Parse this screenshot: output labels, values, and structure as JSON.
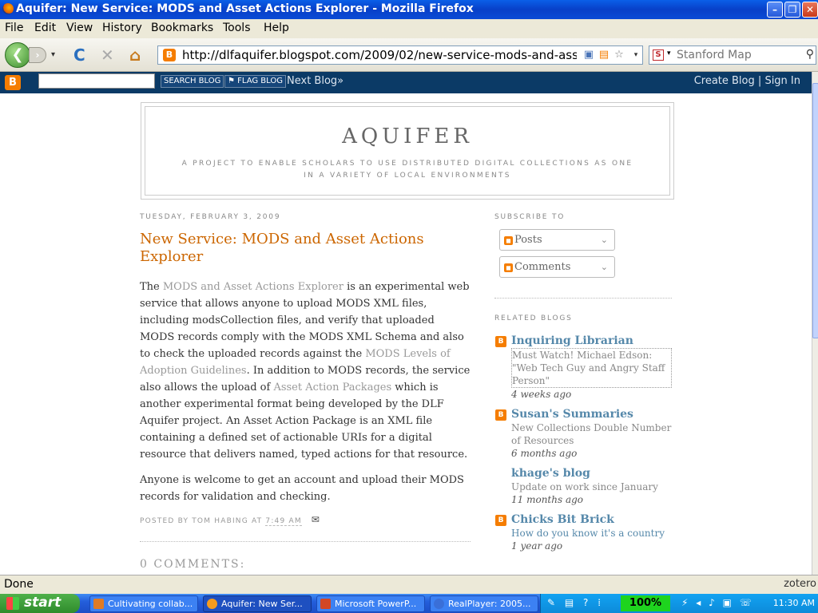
{
  "window": {
    "title": "Aquifer: New Service: MODS and Asset Actions Explorer - Mozilla Firefox",
    "minimize": "–",
    "maximize": "❐",
    "close": "✕"
  },
  "menu": [
    "File",
    "Edit",
    "View",
    "History",
    "Bookmarks",
    "Tools",
    "Help"
  ],
  "nav": {
    "back": "❮",
    "forward": "›",
    "reload": "C",
    "stop": "✕",
    "home": "⌂",
    "url": "http://dlfaquifer.blogspot.com/2009/02/new-service-mods-and-asset-actions",
    "site_favicon": "B",
    "search_engine": "S",
    "search_placeholder": "Stanford Map"
  },
  "blogger_bar": {
    "logo": "B",
    "search_button": "SEARCH BLOG",
    "flag_button": "FLAG BLOG",
    "next_blog": "Next Blog»",
    "create_blog": "Create Blog",
    "divider": "|",
    "sign_in": "Sign In"
  },
  "blog": {
    "title": "AQUIFER",
    "description": "A PROJECT TO ENABLE SCHOLARS TO USE DISTRIBUTED DIGITAL COLLECTIONS AS ONE IN A VARIETY OF LOCAL ENVIRONMENTS"
  },
  "post": {
    "date": "TUESDAY, FEBRUARY 3, 2009",
    "title": "New Service: MODS and Asset Actions Explorer",
    "p1": {
      "t1": "The ",
      "l1": "MODS and Asset Actions Explorer",
      "t2": " is an experimental web service that allows anyone to upload MODS XML files, including modsCollection files, and verify that uploaded MODS records comply with the MODS XML Schema and also to check the uploaded records against the ",
      "l2": "MODS Levels of Adoption Guidelines",
      "t3": ". In addition to MODS records, the service also allows the upload of ",
      "l3": "Asset Action Packages",
      "t4": " which is another experimental format being developed by the DLF Aquifer project. An Asset Action Package is an XML file containing a defined set of actionable URIs for a digital resource that delivers named, typed actions for that resource."
    },
    "p2": "Anyone is welcome to get an account and upload their MODS records for validation and checking.",
    "posted_by": "POSTED BY TOM HABING AT ",
    "time": "7:49 AM",
    "mail_icon": "✉",
    "comments_heading": "0 COMMENTS:"
  },
  "sidebar": {
    "subscribe_heading": "SUBSCRIBE TO",
    "posts": "Posts",
    "comments": "Comments",
    "chevron": "⌄",
    "related_heading": "RELATED BLOGS",
    "related": [
      {
        "name": "Inquiring Librarian",
        "post": "Must Watch! Michael Edson: \"Web Tech Guy and Angry Staff Person\"",
        "age": "4 weeks ago"
      },
      {
        "name": "Susan's Summaries",
        "post": "New Collections Double Number of Resources",
        "age": "6 months ago"
      },
      {
        "name": "khage's blog",
        "post": "Update on work since January",
        "age": "11 months ago"
      },
      {
        "name": "Chicks Bit Brick",
        "post": "How do you know it's a country",
        "age": "1 year ago"
      }
    ]
  },
  "status": {
    "text": "Done",
    "zotero": "zotero"
  },
  "taskbar": {
    "start": "start",
    "tasks": [
      "Cultivating collab...",
      "Aquifer: New Ser...",
      "Microsoft PowerP...",
      "RealPlayer: 2005..."
    ],
    "zoom": "100%",
    "clock": "11:30 AM"
  },
  "colors": {
    "accent": "#cc6600",
    "link": "#5588aa",
    "blogger_orange": "#f57d00",
    "blogger_bar": "#0b3a66"
  }
}
